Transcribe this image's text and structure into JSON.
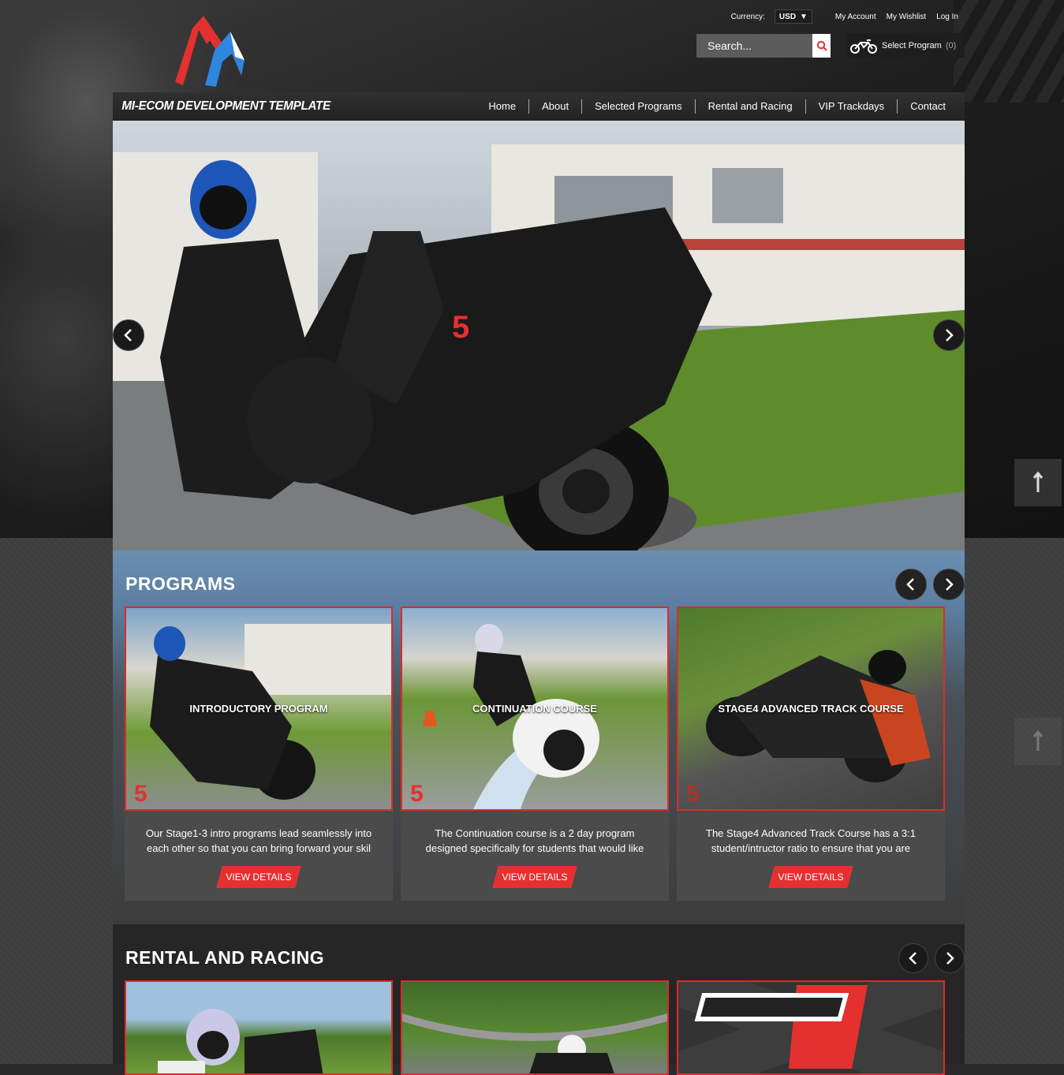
{
  "header": {
    "currency_label": "Currency:",
    "currency_value": "USD",
    "links": [
      "My Account",
      "My Wishlist",
      "Log In"
    ],
    "search_placeholder": "Search...",
    "cart_label": "Select Program",
    "cart_count": "(0)",
    "site_title": "MI-ECOM DEVELOPMENT TEMPLATE",
    "nav": [
      "Home",
      "About",
      "Selected Programs",
      "Rental and Racing",
      "VIP Trackdays",
      "Contact"
    ]
  },
  "programs": {
    "title": "PROGRAMS",
    "cards": [
      {
        "label": "INTRODUCTORY PROGRAM",
        "desc1": "Our Stage1-3 intro programs lead seamlessly into",
        "desc2": "each other so that you can bring forward your skil",
        "button": "VIEW DETAILS"
      },
      {
        "label": "CONTINUATION COURSE",
        "desc1": "The Continuation course is a 2 day program",
        "desc2": "designed specifically for students that would like",
        "button": "VIEW DETAILS"
      },
      {
        "label": "STAGE4 ADVANCED TRACK COURSE",
        "desc1": "The Stage4 Advanced Track Course has a 3:1",
        "desc2": "student/intructor ratio to ensure that you are",
        "button": "VIEW DETAILS"
      }
    ]
  },
  "rental": {
    "title": "RENTAL AND RACING"
  },
  "colors": {
    "accent": "#e53030",
    "dark": "#1e1e1e"
  }
}
